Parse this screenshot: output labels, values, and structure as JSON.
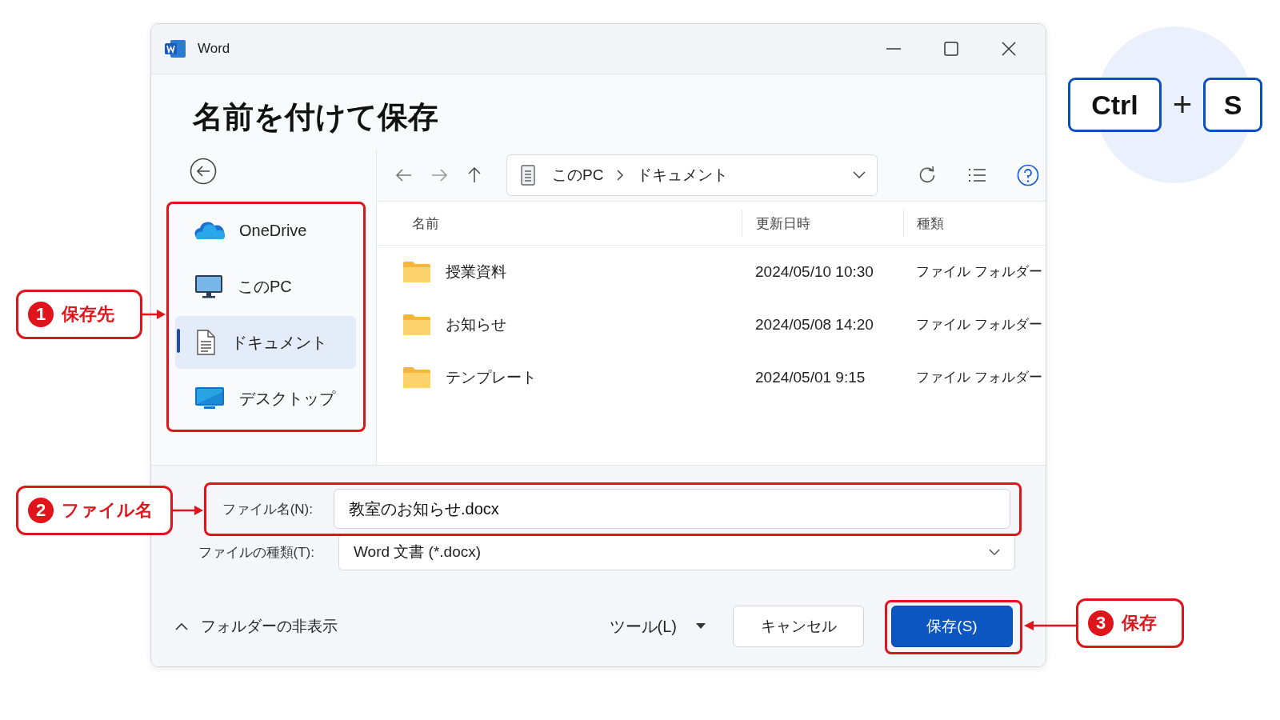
{
  "window": {
    "app_name": "Word",
    "title": "名前を付けて保存"
  },
  "sidebar": {
    "items": [
      {
        "label": "OneDrive",
        "kind": "cloud",
        "selected": false
      },
      {
        "label": "このPC",
        "kind": "computer",
        "selected": false
      },
      {
        "label": "ドキュメント",
        "kind": "document",
        "selected": true
      },
      {
        "label": "デスクトップ",
        "kind": "desktop",
        "selected": false
      }
    ]
  },
  "address_bar": {
    "segments": [
      "このPC",
      "ドキュメント"
    ]
  },
  "table": {
    "columns": [
      "名前",
      "更新日時",
      "種類"
    ],
    "rows": [
      {
        "name": "授業資料",
        "modified": "2024/05/10 10:30",
        "type": "ファイル フォルダー"
      },
      {
        "name": "お知らせ",
        "modified": "2024/05/08 14:20",
        "type": "ファイル フォルダー"
      },
      {
        "name": "テンプレート",
        "modified": "2024/05/01 9:15",
        "type": "ファイル フォルダー"
      }
    ]
  },
  "filename": {
    "label": "ファイル名(N):",
    "value": "教室のお知らせ.docx"
  },
  "filetype": {
    "label": "ファイルの種類(T):",
    "value": "Word 文書 (*.docx)"
  },
  "hide_folders": "フォルダーの非表示",
  "tools": "ツール(L)",
  "buttons": [
    {
      "label": "キャンセル",
      "kind": "secondary"
    },
    {
      "label": "保存(S)",
      "kind": "primary"
    }
  ],
  "callouts": [
    {
      "number": "1",
      "label": "保存先"
    },
    {
      "number": "2",
      "label": "ファイル名"
    },
    {
      "number": "3",
      "label": "保存"
    }
  ],
  "shortcut": {
    "keys": [
      "Ctrl",
      "S"
    ],
    "joiner": "+"
  }
}
